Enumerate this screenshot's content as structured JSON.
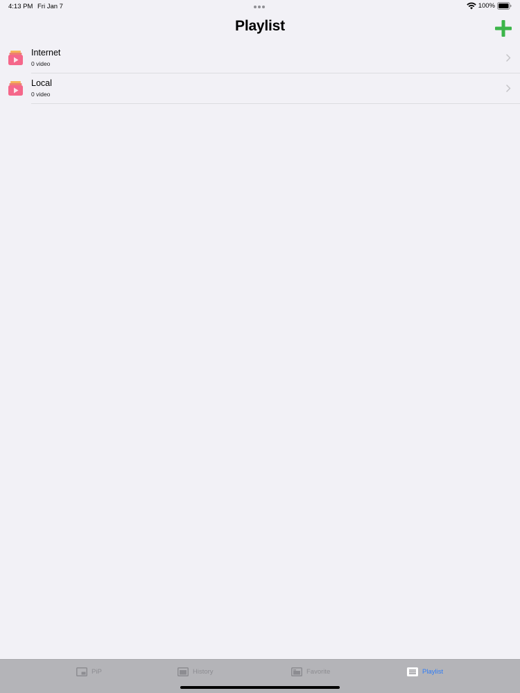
{
  "status_bar": {
    "time": "4:13 PM",
    "date": "Fri Jan 7",
    "battery": "100%"
  },
  "header": {
    "title": "Playlist",
    "add_icon": "plus-icon",
    "accent_color": "#3cb54a"
  },
  "playlists": [
    {
      "title": "Internet",
      "subtitle": "0 video",
      "icon": "video-folder-icon"
    },
    {
      "title": "Local",
      "subtitle": "0 video",
      "icon": "video-folder-icon"
    }
  ],
  "tab_bar": {
    "tabs": [
      {
        "label": "PiP",
        "icon": "pip-icon",
        "active": false
      },
      {
        "label": "History",
        "icon": "history-icon",
        "active": false
      },
      {
        "label": "Favorite",
        "icon": "favorite-icon",
        "active": false
      },
      {
        "label": "Playlist",
        "icon": "playlist-icon",
        "active": true
      }
    ],
    "active_color": "#2f7cf6",
    "inactive_color": "#8c8c91"
  }
}
